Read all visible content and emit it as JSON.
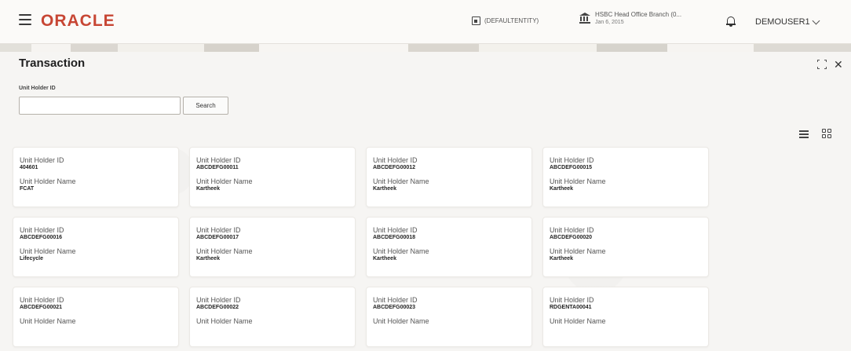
{
  "header": {
    "logo": "ORACLE",
    "entity": "(DEFAULTENTITY)",
    "branch_name": "HSBC Head Office Branch (0...",
    "branch_date": "Jan 6, 2015",
    "user": "DEMOUSER1"
  },
  "page": {
    "title": "Transaction"
  },
  "search": {
    "label": "Unit Holder ID",
    "value": "",
    "placeholder": "",
    "button": "Search"
  },
  "cards": [
    {
      "id_label": "Unit Holder ID",
      "id": "404601",
      "name_label": "Unit Holder Name",
      "name": "FCAT"
    },
    {
      "id_label": "Unit Holder ID",
      "id": "ABCDEFG00011",
      "name_label": "Unit Holder Name",
      "name": "Kartheek"
    },
    {
      "id_label": "Unit Holder ID",
      "id": "ABCDEFG00012",
      "name_label": "Unit Holder Name",
      "name": "Kartheek"
    },
    {
      "id_label": "Unit Holder ID",
      "id": "ABCDEFG00015",
      "name_label": "Unit Holder Name",
      "name": "Kartheek"
    },
    {
      "id_label": "Unit Holder ID",
      "id": "ABCDEFG00016",
      "name_label": "Unit Holder Name",
      "name": "Lifecycle"
    },
    {
      "id_label": "Unit Holder ID",
      "id": "ABCDEFG00017",
      "name_label": "Unit Holder Name",
      "name": "Kartheek"
    },
    {
      "id_label": "Unit Holder ID",
      "id": "ABCDEFG00018",
      "name_label": "Unit Holder Name",
      "name": "Kartheek"
    },
    {
      "id_label": "Unit Holder ID",
      "id": "ABCDEFG00020",
      "name_label": "Unit Holder Name",
      "name": "Kartheek"
    },
    {
      "id_label": "Unit Holder ID",
      "id": "ABCDEFG00021",
      "name_label": "Unit Holder Name",
      "name": ""
    },
    {
      "id_label": "Unit Holder ID",
      "id": "ABCDEFG00022",
      "name_label": "Unit Holder Name",
      "name": ""
    },
    {
      "id_label": "Unit Holder ID",
      "id": "ABCDEFG00023",
      "name_label": "Unit Holder Name",
      "name": ""
    },
    {
      "id_label": "Unit Holder ID",
      "id": "RDGENTA00041",
      "name_label": "Unit Holder Name",
      "name": ""
    }
  ],
  "icons": {
    "menu": "hamburger-menu-icon",
    "entity": "entity-icon",
    "branch": "bank-branch-icon",
    "notifications": "bell-icon",
    "user_menu": "chevron-down-icon",
    "maximize": "maximize-icon",
    "close": "close-icon",
    "list_view": "list-view-icon",
    "grid_view": "grid-view-icon"
  },
  "colors": {
    "brand": "#c74634",
    "background": "#f6f5f3",
    "card": "#ffffff"
  }
}
